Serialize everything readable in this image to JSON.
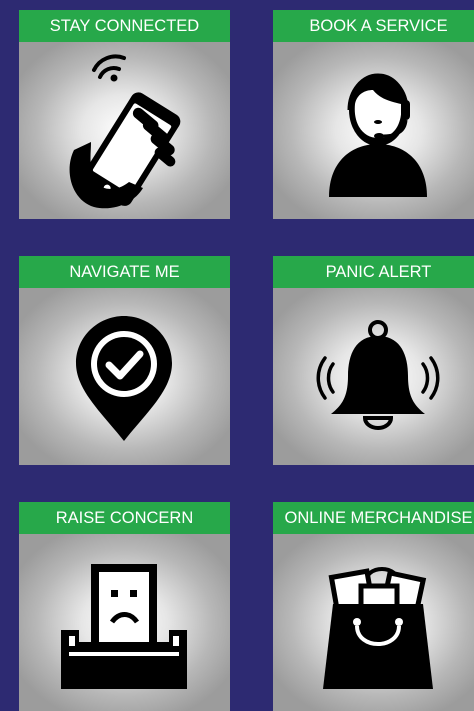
{
  "tiles": [
    {
      "label": "STAY CONNECTED",
      "icon": "hand-phone-wifi-icon"
    },
    {
      "label": "BOOK A SERVICE",
      "icon": "support-agent-headset-icon"
    },
    {
      "label": "NAVIGATE ME",
      "icon": "location-pin-check-icon"
    },
    {
      "label": "PANIC ALERT",
      "icon": "ringing-bell-icon"
    },
    {
      "label": "RAISE CONCERN",
      "icon": "sad-document-tray-icon"
    },
    {
      "label": "ONLINE MERCHANDISE",
      "icon": "shopping-bag-icon"
    }
  ],
  "colors": {
    "background": "#2d2a72",
    "label_bar": "#27a84a",
    "label_text": "#ffffff",
    "icon": "#000000"
  }
}
